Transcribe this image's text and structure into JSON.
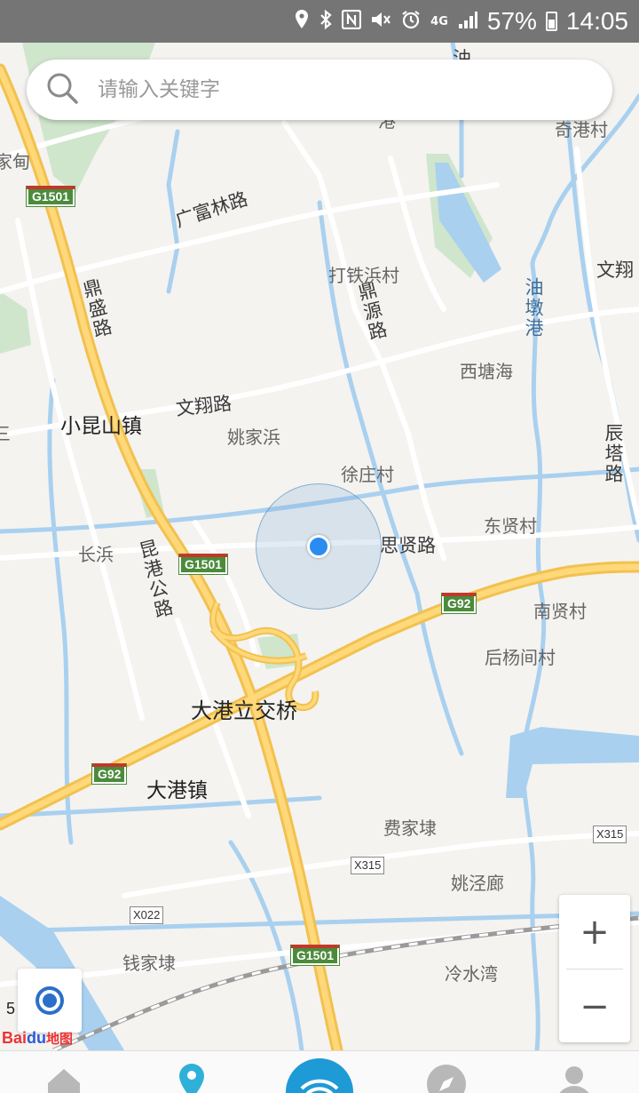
{
  "status_bar": {
    "battery": "57%",
    "time": "14:05",
    "network": "4G"
  },
  "search": {
    "placeholder": "请输入关键字"
  },
  "map": {
    "place_labels": [
      "奇港村",
      "打铁浜村",
      "西塘海",
      "小昆山镇",
      "姚家浜",
      "徐庄村",
      "长浜",
      "东贤村",
      "南贤村",
      "后杨间村",
      "大港镇",
      "费家埭",
      "姚泾廊",
      "钱家埭",
      "冷水湾"
    ],
    "landmark_labels": [
      "大港立交桥"
    ],
    "road_labels": [
      "广富林路",
      "鼎盛路",
      "鼎源路",
      "文翔路",
      "思贤路",
      "昆港公路",
      "辰塔路",
      "文翔"
    ],
    "water_labels": [
      "油墩港"
    ],
    "edge_labels": [
      "家甸",
      "油",
      "港",
      "三"
    ],
    "shields": [
      "G1501",
      "G1501",
      "G92",
      "G92",
      "G1501"
    ],
    "county_shields": [
      "X315",
      "X315",
      "X022"
    ]
  },
  "zoom": {
    "in_label": "+",
    "out_label": "−"
  },
  "scale": {
    "label": "5"
  },
  "logo": {
    "text": "Bai",
    "text2": "du",
    "text3": "地图"
  }
}
